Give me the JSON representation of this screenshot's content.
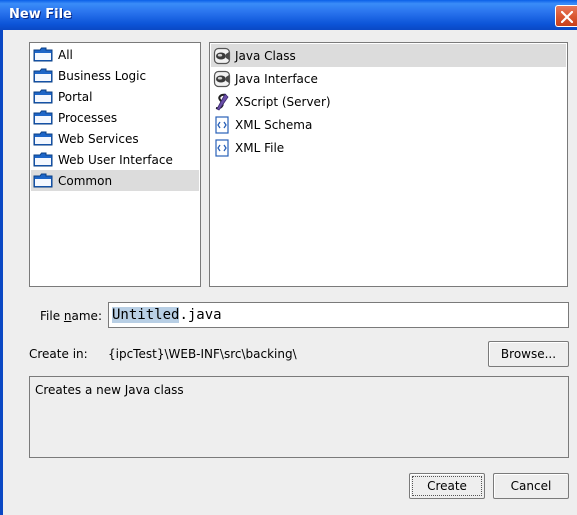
{
  "window": {
    "title": "New File"
  },
  "categories": [
    {
      "label": "All",
      "selected": false
    },
    {
      "label": "Business Logic",
      "selected": false
    },
    {
      "label": "Portal",
      "selected": false
    },
    {
      "label": "Processes",
      "selected": false
    },
    {
      "label": "Web Services",
      "selected": false
    },
    {
      "label": "Web User Interface",
      "selected": false
    },
    {
      "label": "Common",
      "selected": true
    }
  ],
  "file_types": [
    {
      "label": "Java Class",
      "icon": "java-class-icon",
      "selected": true
    },
    {
      "label": "Java Interface",
      "icon": "java-interface-icon",
      "selected": false
    },
    {
      "label": "XScript (Server)",
      "icon": "xscript-icon",
      "selected": false
    },
    {
      "label": "XML Schema",
      "icon": "xml-schema-icon",
      "selected": false
    },
    {
      "label": "XML File",
      "icon": "xml-file-icon",
      "selected": false
    }
  ],
  "file_name": {
    "label": "File name:",
    "label_mnemonic": "n",
    "value_selected": "Untitled",
    "value_ext": ".java"
  },
  "create_in": {
    "label": "Create in:",
    "path": "{ipcTest}\\WEB-INF\\src\\backing\\"
  },
  "browse_label": "Browse...",
  "description": "Creates a new Java class",
  "buttons": {
    "create": "Create",
    "cancel": "Cancel"
  },
  "colors": {
    "titlebar": "#0A5FE8",
    "selection": "#DCDCDC",
    "text_selection": "#B8CFE5",
    "close": "#D9552F"
  }
}
